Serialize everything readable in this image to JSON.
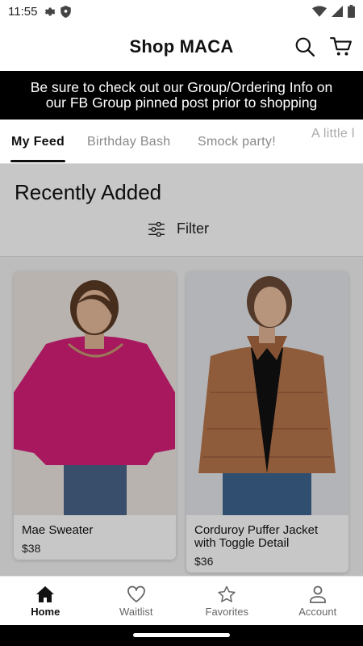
{
  "status_bar": {
    "time": "11:55"
  },
  "header": {
    "title": "Shop MACA"
  },
  "banner": {
    "line1": "Be sure to check out our Group/Ordering Info on",
    "line2": "our FB Group pinned post prior to shopping"
  },
  "tabs": [
    {
      "label": "My Feed"
    },
    {
      "label": "Birthday Bash"
    },
    {
      "label": "Smock party!"
    },
    {
      "label": "A little l"
    }
  ],
  "section": {
    "title": "Recently Added",
    "filter_label": "Filter"
  },
  "products": [
    {
      "name": "Mae Sweater",
      "price": "$38"
    },
    {
      "name": "Corduroy Puffer Jacket with Toggle Detail",
      "price": "$36"
    }
  ],
  "bottom_nav": [
    {
      "label": "Home",
      "icon": "home-icon"
    },
    {
      "label": "Waitlist",
      "icon": "heart-icon"
    },
    {
      "label": "Favorites",
      "icon": "star-icon"
    },
    {
      "label": "Account",
      "icon": "account-icon"
    }
  ]
}
